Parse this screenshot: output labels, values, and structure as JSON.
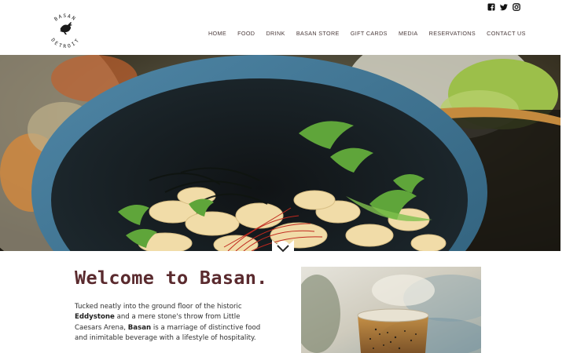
{
  "social": {
    "icons": [
      "facebook-icon",
      "twitter-icon",
      "instagram-icon"
    ]
  },
  "logo": {
    "top_text": "BASAN",
    "bottom_text": "DETROIT",
    "icon": "heron-bird-icon"
  },
  "nav": {
    "items": [
      {
        "label": "HOME"
      },
      {
        "label": "FOOD"
      },
      {
        "label": "DRINK"
      },
      {
        "label": "BASAN STORE"
      },
      {
        "label": "GIFT CARDS"
      },
      {
        "label": "MEDIA"
      },
      {
        "label": "RESERVATIONS"
      },
      {
        "label": "CONTACT US"
      }
    ]
  },
  "hero": {
    "scroll_icon": "chevron-down-icon"
  },
  "welcome": {
    "title": "Welcome to Basan.",
    "p1": "Tucked neatly into the ground floor of the historic",
    "bold1": "Eddystone",
    "p2": " and a mere stone's throw from Little Caesars Arena, ",
    "bold2": "Basan",
    "p3": " is a marriage of distinctive food and inimitable beverage with a lifestyle of hospitality."
  },
  "colors": {
    "title": "#5a2a2e",
    "nav_text": "#4a3a3a",
    "body_text": "#2e2e2e"
  }
}
